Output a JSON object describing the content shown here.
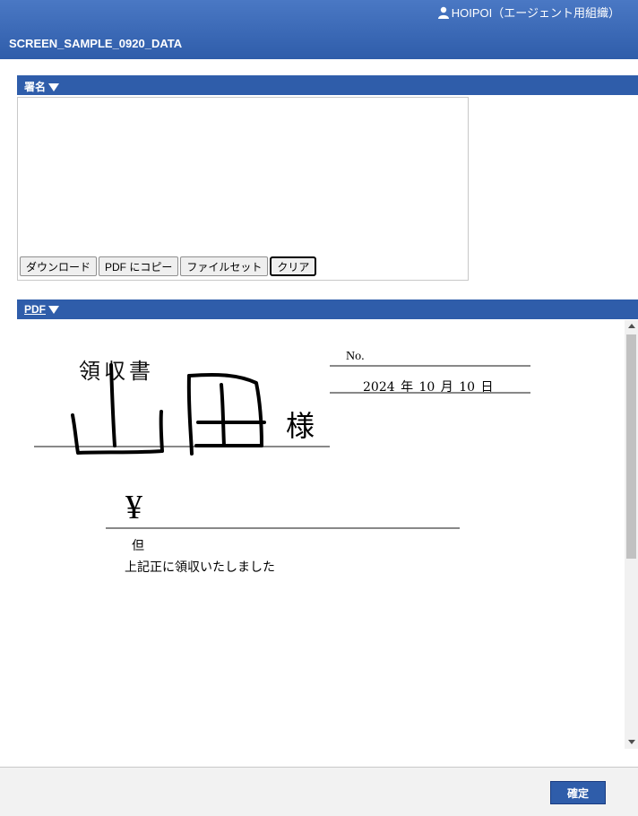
{
  "header": {
    "user_label": "HOIPOI（エージェント用組織）",
    "app_title": "SCREEN_SAMPLE_0920_DATA"
  },
  "signature_section": {
    "title": "署名",
    "buttons": {
      "download": "ダウンロード",
      "copy_to_pdf": "PDF にコピー",
      "file_set": "ファイルセット",
      "clear": "クリア"
    }
  },
  "pdf_section": {
    "title": "PDF",
    "receipt": {
      "title": "領収書",
      "no_label": "No.",
      "date": "2024 年 10 月 10 日",
      "honorific": "様",
      "yen_symbol": "¥",
      "tadashi": "但",
      "confirmation": "上記正に領収いたしました",
      "handwritten_name": "山田"
    }
  },
  "footer": {
    "confirm_label": "確定"
  },
  "colors": {
    "header_gradient_top": "#4a78c4",
    "accent": "#2f5daa"
  }
}
